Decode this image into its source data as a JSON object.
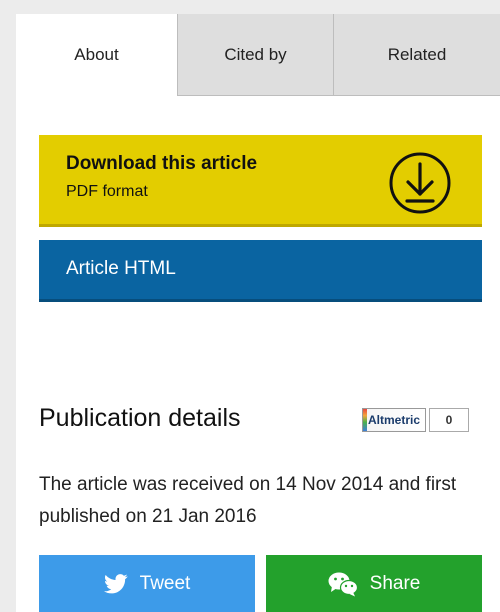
{
  "tabs": [
    {
      "label": "About",
      "active": true
    },
    {
      "label": "Cited by",
      "active": false
    },
    {
      "label": "Related",
      "active": false
    }
  ],
  "download": {
    "title": "Download this article",
    "subtitle": "PDF format",
    "icon": "download-icon"
  },
  "article_html": {
    "label": "Article HTML"
  },
  "publication": {
    "heading": "Publication details",
    "altmetric_label": "Altmetric",
    "altmetric_score": "0",
    "text": "The article was received on 14 Nov 2014 and first published on 21 Jan 2016"
  },
  "share": {
    "tweet_label": "Tweet",
    "tweet_icon": "twitter-bird-icon",
    "share_label": "Share",
    "share_icon": "wechat-icon"
  },
  "colors": {
    "download_bg": "#e3cd00",
    "html_bg": "#0a64a1",
    "tweet_bg": "#3d9be9",
    "share_bg": "#23a12c"
  }
}
